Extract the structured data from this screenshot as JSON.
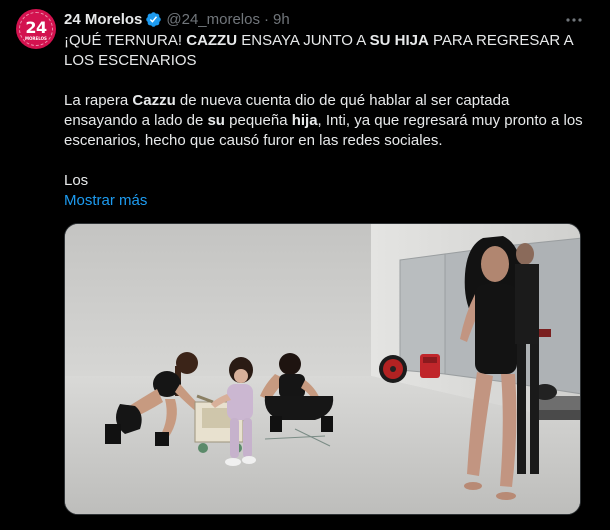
{
  "tweet": {
    "display_name": "24 Morelos",
    "handle": "@24_morelos",
    "separator": "·",
    "time": "9h",
    "avatar_text": "24",
    "avatar_subtext": "MORELOS",
    "headline": {
      "p1": "¡QUÉ TERNURA! ",
      "b1": "CAZZU",
      "p2": " ENSAYA JUNTO A ",
      "b2": "SU HIJA",
      "p3": " PARA REGRESAR A LOS ESCENARIOS"
    },
    "body": {
      "p1": "La rapera ",
      "b1": "Cazzu",
      "p2": " de nueva cuenta dio de qué hablar al ser captada ensayando a lado de ",
      "b2": "su",
      "p3": " pequeña ",
      "b3": "hija",
      "p4": ", Inti, ya que regresará muy pronto a los escenarios, hecho que causó furor en las redes sociales."
    },
    "trailing": "Los",
    "show_more": "Mostrar más"
  },
  "icons": {
    "verified": "verified-badge-icon",
    "more": "more-options-icon"
  },
  "colors": {
    "background": "#000000",
    "text": "#e7e9ea",
    "muted": "#71767b",
    "link": "#1d9bf0",
    "verified": "#1d9bf0",
    "avatar": "#d3124f"
  }
}
